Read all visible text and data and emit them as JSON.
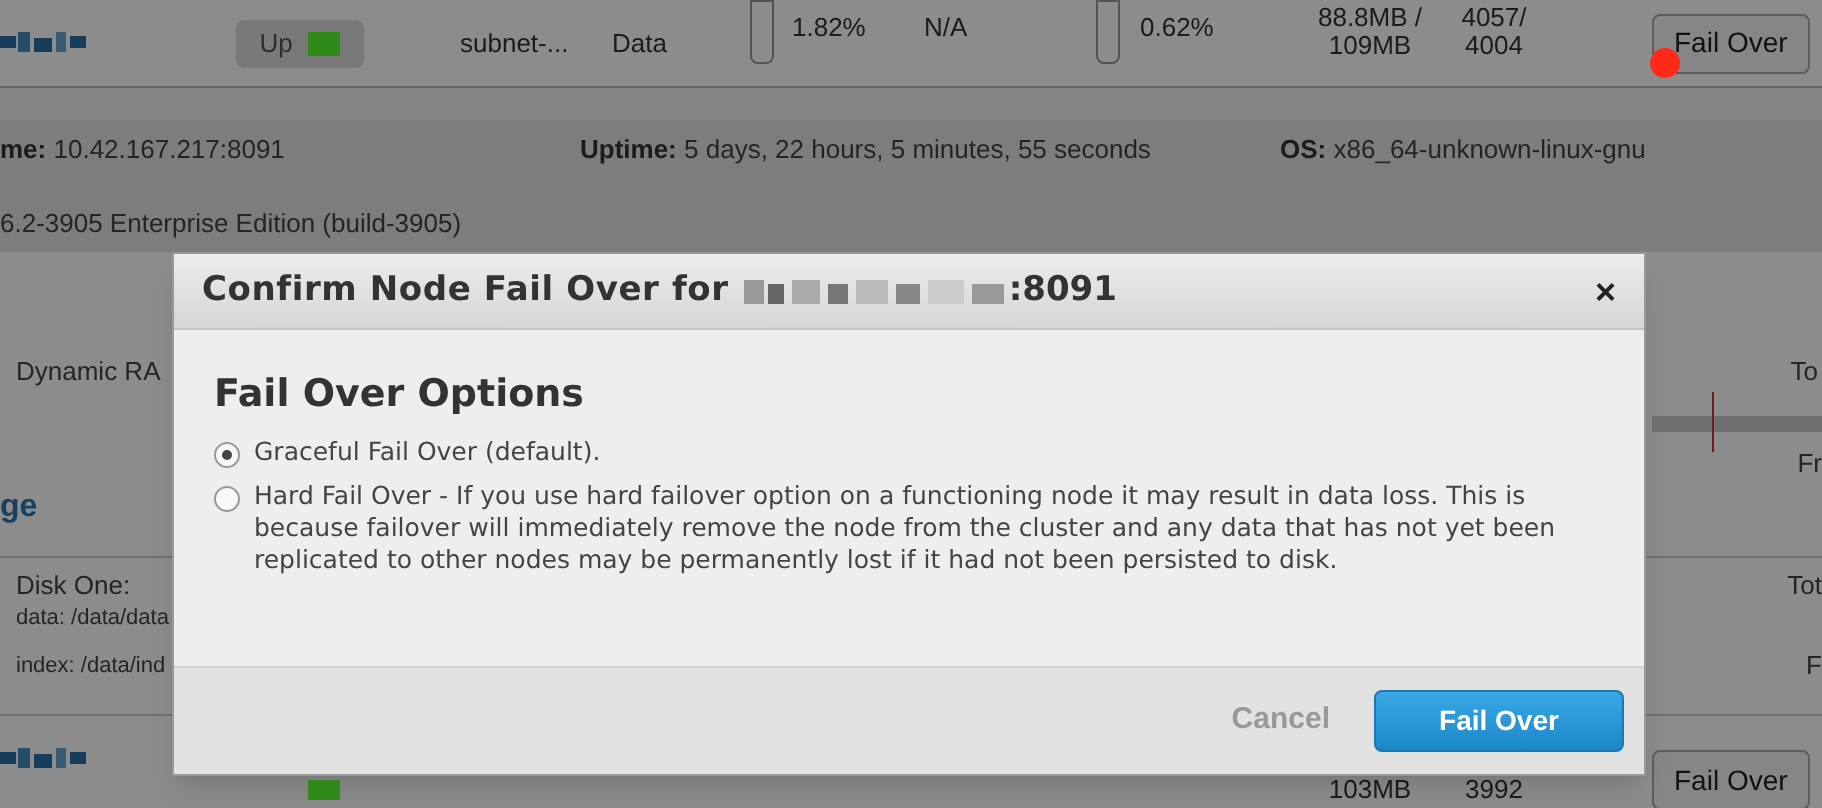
{
  "nodes": [
    {
      "status": "Up",
      "color": "#2f8a1a",
      "subnet": "subnet-...",
      "service": "Data",
      "cpu": "1.82%",
      "swap": "N/A",
      "ram": "0.62%",
      "data_size": "88.8MB / 109MB",
      "items": "4057/ 4004",
      "button": "Fail Over",
      "marked": true
    },
    {
      "color": "#2f8a1a",
      "data_size": "103MB",
      "items": "3992",
      "button": "Fail Over",
      "marked": false
    }
  ],
  "details": {
    "name_label": "me:",
    "name": "10.42.167.217:8091",
    "uptime_label": "Uptime:",
    "uptime": "5 days, 22 hours, 5 minutes, 55 seconds",
    "os_label": "OS:",
    "os": "x86_64-unknown-linux-gnu",
    "version": "6.2-3905 Enterprise Edition (build-3905)"
  },
  "memory": {
    "label": "Dynamic RA",
    "total": "To",
    "free": "Fr"
  },
  "storage": {
    "heading": "ge",
    "disk": "Disk One:",
    "data_path": "data: /data/data",
    "index_path": "index: /data/ind",
    "total": "Tot",
    "free": "F"
  },
  "modal": {
    "title": "Confirm Node Fail Over for",
    "title_suffix": ":8091",
    "close": "×",
    "heading": "Fail Over Options",
    "options": [
      {
        "label": "Graceful Fail Over (default).",
        "selected": true
      },
      {
        "label": "Hard Fail Over - If you use hard failover option on a functioning node it may result in data loss. This is because failover will immediately remove the node from the cluster and any data that has not yet been replicated to other nodes may be permanently lost if it had not been persisted to disk.",
        "selected": false
      }
    ],
    "cancel": "Cancel",
    "confirm": "Fail Over"
  }
}
